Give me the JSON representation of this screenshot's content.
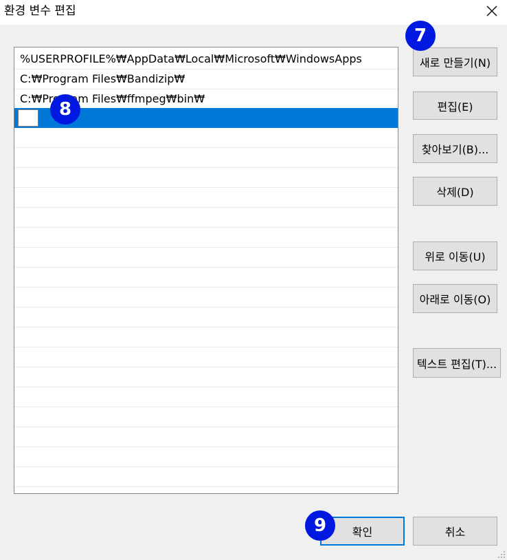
{
  "window": {
    "title": "환경 변수 편집"
  },
  "list": {
    "items": [
      "%USERPROFILE%₩AppData₩Local₩Microsoft₩WindowsApps",
      "C:₩Program Files₩Bandizip₩",
      "C:₩Program Files₩ffmpeg₩bin₩",
      ""
    ],
    "selected_index": 3,
    "selection_color": "#0078d7"
  },
  "buttons": {
    "new": "새로 만들기(N)",
    "edit": "편집(E)",
    "browse": "찾아보기(B)...",
    "delete": "삭제(D)",
    "move_up": "위로 이동(U)",
    "move_down": "아래로 이동(O)",
    "edit_text": "텍스트 편집(T)...",
    "ok": "확인",
    "cancel": "취소"
  },
  "markers": {
    "m7": "7",
    "m8": "8",
    "m9": "9"
  },
  "icons": {
    "close": "close-icon",
    "resize": "resize-grip-icon"
  }
}
